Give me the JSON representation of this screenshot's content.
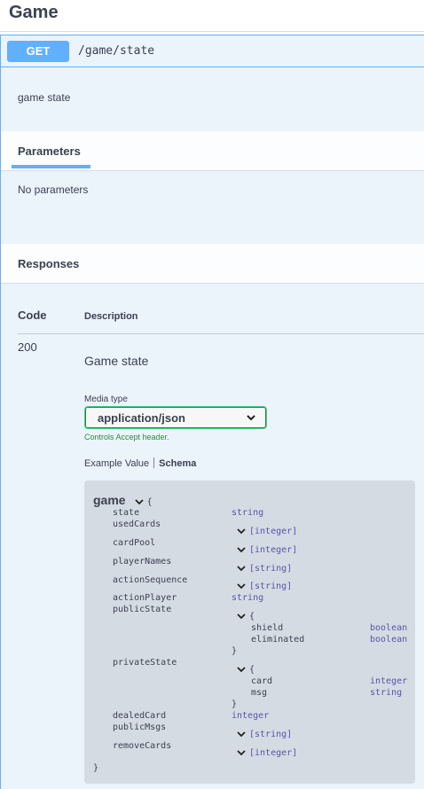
{
  "section": {
    "title": "Game"
  },
  "operation": {
    "method": "GET",
    "path": "/game/state",
    "description": "game state"
  },
  "parameters": {
    "tab_label": "Parameters",
    "empty_text": "No parameters"
  },
  "responses": {
    "title": "Responses",
    "col_code": "Code",
    "col_description": "Description",
    "items": [
      {
        "code": "200",
        "description": "Game state",
        "media_type_label": "Media type",
        "media_type_value": "application/json",
        "controls_hint": "Controls Accept header.",
        "example_tab": "Example Value",
        "schema_tab": "Schema"
      }
    ]
  },
  "schema": {
    "name": "game",
    "open_brace": "{",
    "close_brace": "}",
    "props": [
      {
        "name": "state",
        "type": "string"
      },
      {
        "name": "usedCards",
        "type": "[integer]"
      },
      {
        "name": "cardPool",
        "type": "[integer]"
      },
      {
        "name": "playerNames",
        "type": "[string]"
      },
      {
        "name": "actionSequence",
        "type": "[string]"
      },
      {
        "name": "actionPlayer",
        "type": "string"
      },
      {
        "name": "publicState",
        "open": "{",
        "close": "}",
        "children": [
          {
            "name": "shield",
            "type": "boolean"
          },
          {
            "name": "eliminated",
            "type": "boolean"
          }
        ]
      },
      {
        "name": "privateState",
        "open": "{",
        "close": "}",
        "children": [
          {
            "name": "card",
            "type": "integer"
          },
          {
            "name": "msg",
            "type": "string"
          }
        ]
      },
      {
        "name": "dealedCard",
        "type": "integer"
      },
      {
        "name": "publicMsgs",
        "type": "[string]"
      },
      {
        "name": "removeCards",
        "type": "[integer]"
      }
    ]
  },
  "colors": {
    "get_accent": "#61affe",
    "op_background": "#ebf3fb",
    "model_background": "#d5dbe2",
    "type_color": "#5555aa",
    "hint_green": "#2f8a3d"
  }
}
